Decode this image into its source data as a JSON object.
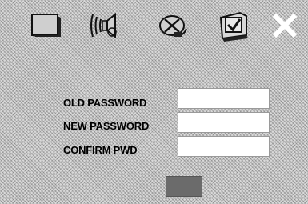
{
  "toolbar": {
    "buttons": [
      {
        "icon": "general-setup-icon"
      },
      {
        "icon": "audio-setup-icon"
      },
      {
        "icon": "video-setup-icon"
      },
      {
        "icon": "preference-setup-icon"
      },
      {
        "icon": "close-icon"
      }
    ]
  },
  "password_form": {
    "old_password_label": "OLD PASSWORD",
    "new_password_label": "NEW PASSWORD",
    "confirm_label": "CONFIRM PWD"
  },
  "colors": {
    "background": "#d9d9d9",
    "field": "#ffffff",
    "button": "#6b6b6b",
    "close_icon": "#ffffff"
  }
}
